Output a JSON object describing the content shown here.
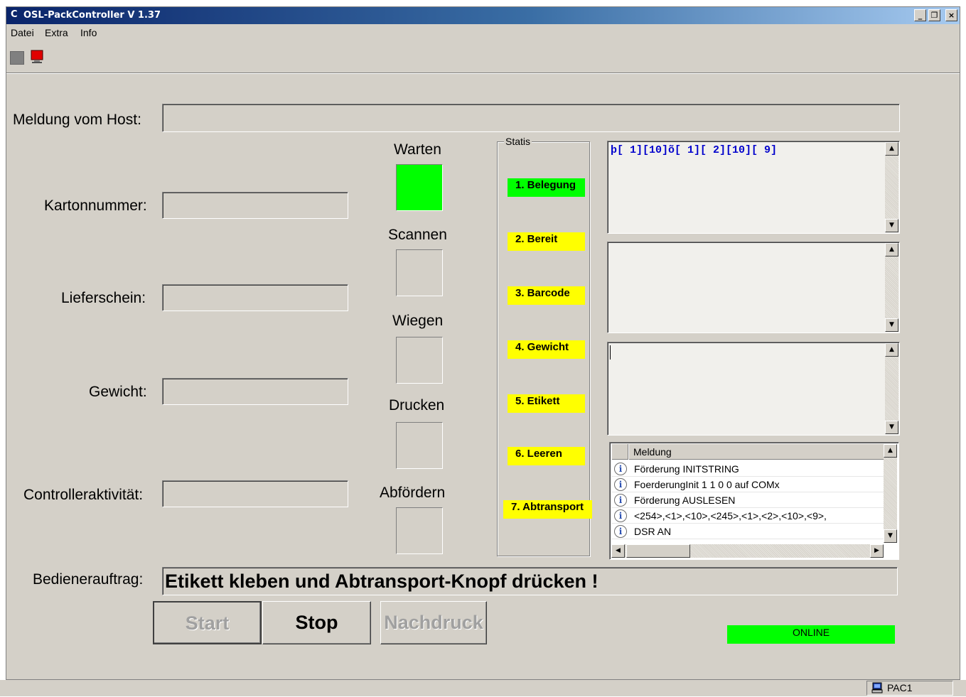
{
  "window": {
    "title": "OSL-PackController V 1.37",
    "minimize": "_",
    "restore": "❐",
    "close": "×"
  },
  "menu": [
    "Datei",
    "Extra",
    "Info"
  ],
  "toolbar": {
    "colors": {
      "gray": "#808080",
      "red": "#e00000"
    }
  },
  "form": {
    "host_message_label": "Meldung vom Host:",
    "host_message_value": "",
    "carton_label": "Kartonnummer:",
    "carton_value": "",
    "delivery_label": "Lieferschein:",
    "delivery_value": "",
    "weight_label": "Gewicht:",
    "weight_value": "",
    "controller_label": "Controlleraktivität:",
    "controller_value": "",
    "operator_label": "Bedienerauftrag:",
    "operator_value": "Etikett kleben und Abtransport-Knopf drücken !"
  },
  "steps": [
    {
      "title": "Warten",
      "active": true
    },
    {
      "title": "Scannen",
      "active": false
    },
    {
      "title": "Wiegen",
      "active": false
    },
    {
      "title": "Drucken",
      "active": false
    },
    {
      "title": "Abfördern",
      "active": false
    }
  ],
  "statis": {
    "title": "Statis",
    "items": [
      {
        "label": "1. Belegung",
        "color": "#00ff00"
      },
      {
        "label": "2. Bereit",
        "color": "#ffff00"
      },
      {
        "label": "3. Barcode",
        "color": "#ffff00"
      },
      {
        "label": "4. Gewicht",
        "color": "#ffff00"
      },
      {
        "label": "5. Etikett",
        "color": "#ffff00"
      },
      {
        "label": "6. Leeren",
        "color": "#ffff00"
      },
      {
        "label": "7. Abtransport",
        "color": "#ffff00"
      }
    ]
  },
  "textboxes": {
    "box1": "þ[ 1][10]õ[ 1][ 2][10][ 9]",
    "box2": "",
    "box3": ""
  },
  "log": {
    "column": "Meldung",
    "rows": [
      "Förderung INITSTRING",
      "FoerderungInit 1 1 0 0 auf COMx",
      "Förderung AUSLESEN",
      "<254>,<1>,<10>,<245>,<1>,<2>,<10>,<9>,",
      "DSR AN"
    ]
  },
  "buttons": {
    "start": "Start",
    "stop": "Stop",
    "reprint": "Nachdruck"
  },
  "status": {
    "online": "ONLINE",
    "online_color": "#00ff00",
    "panel": "PAC1"
  }
}
